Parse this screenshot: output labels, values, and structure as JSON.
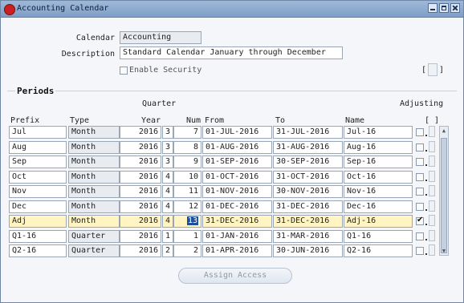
{
  "window": {
    "title": "Accounting Calendar"
  },
  "form": {
    "calendar_label": "Calendar",
    "calendar_value": "Accounting",
    "description_label": "Description",
    "description_value": "Standard Calendar January through December",
    "enable_security_label": "Enable Security",
    "enable_security_checked": false,
    "df_bracket": "[ ]"
  },
  "periods": {
    "section_title": "Periods",
    "headers": {
      "prefix": "Prefix",
      "type": "Type",
      "quarter": "Quarter",
      "year": "Year",
      "num": "Num",
      "from": "From",
      "to": "To",
      "name": "Name",
      "adjusting": "Adjusting",
      "df": "[ ]"
    },
    "rows": [
      {
        "prefix": "Jul",
        "type": "Month",
        "year": "2016",
        "quarter": "3",
        "num": "7",
        "from": "01-JUL-2016",
        "to": "31-JUL-2016",
        "name": "Jul-16",
        "adjusting": false
      },
      {
        "prefix": "Aug",
        "type": "Month",
        "year": "2016",
        "quarter": "3",
        "num": "8",
        "from": "01-AUG-2016",
        "to": "31-AUG-2016",
        "name": "Aug-16",
        "adjusting": false
      },
      {
        "prefix": "Sep",
        "type": "Month",
        "year": "2016",
        "quarter": "3",
        "num": "9",
        "from": "01-SEP-2016",
        "to": "30-SEP-2016",
        "name": "Sep-16",
        "adjusting": false
      },
      {
        "prefix": "Oct",
        "type": "Month",
        "year": "2016",
        "quarter": "4",
        "num": "10",
        "from": "01-OCT-2016",
        "to": "31-OCT-2016",
        "name": "Oct-16",
        "adjusting": false
      },
      {
        "prefix": "Nov",
        "type": "Month",
        "year": "2016",
        "quarter": "4",
        "num": "11",
        "from": "01-NOV-2016",
        "to": "30-NOV-2016",
        "name": "Nov-16",
        "adjusting": false
      },
      {
        "prefix": "Dec",
        "type": "Month",
        "year": "2016",
        "quarter": "4",
        "num": "12",
        "from": "01-DEC-2016",
        "to": "31-DEC-2016",
        "name": "Dec-16",
        "adjusting": false
      },
      {
        "prefix": "Adj",
        "type": "Month",
        "year": "2016",
        "quarter": "4",
        "num": "13",
        "from": "31-DEC-2016",
        "to": "31-DEC-2016",
        "name": "Adj-16",
        "adjusting": true
      },
      {
        "prefix": "Q1-16",
        "type": "Quarter",
        "year": "2016",
        "quarter": "1",
        "num": "1",
        "from": "01-JAN-2016",
        "to": "31-MAR-2016",
        "name": "Q1-16",
        "adjusting": false
      },
      {
        "prefix": "Q2-16",
        "type": "Quarter",
        "year": "2016",
        "quarter": "2",
        "num": "2",
        "from": "01-APR-2016",
        "to": "30-JUN-2016",
        "name": "Q2-16",
        "adjusting": false
      }
    ],
    "current_row": 6
  },
  "buttons": {
    "assign_access": "Assign Access"
  },
  "colors": {
    "title_bar": "#8faad0",
    "current_row": "#fff4c2",
    "selection": "#1f4f96"
  }
}
